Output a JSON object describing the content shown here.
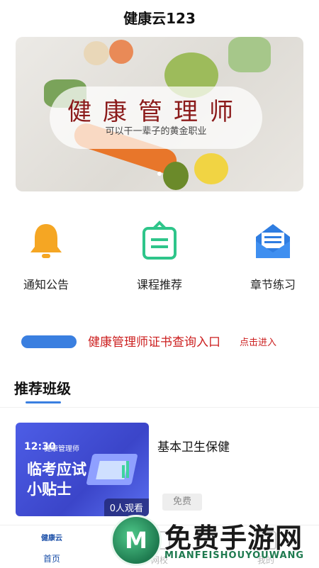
{
  "header": {
    "title": "健康云123"
  },
  "banner": {
    "title": "健康管理师",
    "subtitle": "可以干一辈子的黄金职业"
  },
  "quick_entries": [
    {
      "label": "通知公告",
      "icon": "bell-icon",
      "color": "#f5a623"
    },
    {
      "label": "课程推荐",
      "icon": "clipboard-icon",
      "color": "#2ec58a"
    },
    {
      "label": "章节练习",
      "icon": "envelope-icon",
      "color": "#2f7de1"
    }
  ],
  "cert_query": {
    "text": "健康管理师证书查询入口",
    "action": "点击进入"
  },
  "recommend": {
    "section_title": "推荐班级",
    "courses": [
      {
        "thumb_time": "12:30",
        "thumb_brand": "健康管理师",
        "thumb_line1": "临考应试",
        "thumb_line2": "小贴士",
        "viewers": "0人观看",
        "name": "基本卫生保健",
        "price_badge": "免费"
      }
    ]
  },
  "tabbar": {
    "items": [
      {
        "logo": "健康云",
        "label": "首页",
        "active": true
      },
      {
        "label": "网校",
        "active": false
      },
      {
        "label": "我的",
        "active": false
      }
    ]
  },
  "watermark": {
    "brand": "免费手游网",
    "domain": "MIANFEISHOUYOUWANG"
  },
  "colors": {
    "accent": "#3a7fe0",
    "link_red": "#cc1f1f"
  }
}
